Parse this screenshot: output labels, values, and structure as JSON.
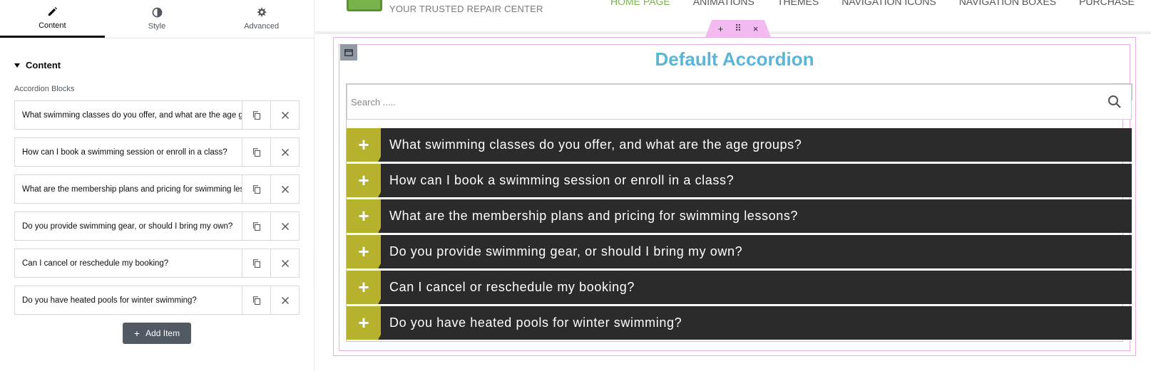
{
  "editor": {
    "tabs": [
      {
        "label": "Content",
        "icon": "pencil-icon",
        "active": true
      },
      {
        "label": "Style",
        "icon": "half-circle-icon",
        "active": false
      },
      {
        "label": "Advanced",
        "icon": "gear-icon",
        "active": false
      }
    ],
    "section_title": "Content",
    "control_label": "Accordion Blocks",
    "items": [
      {
        "title": "What swimming classes do you offer, and what are the age groups?"
      },
      {
        "title": "How can I book a swimming session or enroll in a class?"
      },
      {
        "title": "What are the membership plans and pricing for swimming lessons?"
      },
      {
        "title": "Do you provide swimming gear, or should I bring my own?"
      },
      {
        "title": "Can I cancel or reschedule my booking?"
      },
      {
        "title": "Do you have heated pools for winter swimming?"
      }
    ],
    "add_item_label": "Add Item",
    "add_item_icon": "+",
    "collapse_icon": "‹"
  },
  "preview": {
    "logo_tagline": "YOUR TRUSTED REPAIR CENTER",
    "nav": [
      "HOME PAGE",
      "ANIMATIONS",
      "THEMES",
      "NAVIGATION ICONS",
      "NAVIGATION BOXES",
      "PURCHASE"
    ],
    "nav_active_color": "#79b34b",
    "section_handle": {
      "add": "+",
      "drag": "⠿",
      "close": "×"
    },
    "accordion_title": "Default Accordion",
    "title_color": "#5ab6d8",
    "search_placeholder": "Search .....",
    "item_icon": "+",
    "icon_bg_color": "#b6b22d",
    "item_bg_color": "#2b2b2b",
    "items": [
      "What swimming classes do you offer, and what are the age groups?",
      "How can I book a swimming session or enroll in a class?",
      "What are the membership plans and pricing for swimming lessons?",
      "Do you provide swimming gear, or should I bring my own?",
      "Can I cancel or reschedule my booking?",
      "Do you have heated pools for winter swimming?"
    ]
  }
}
